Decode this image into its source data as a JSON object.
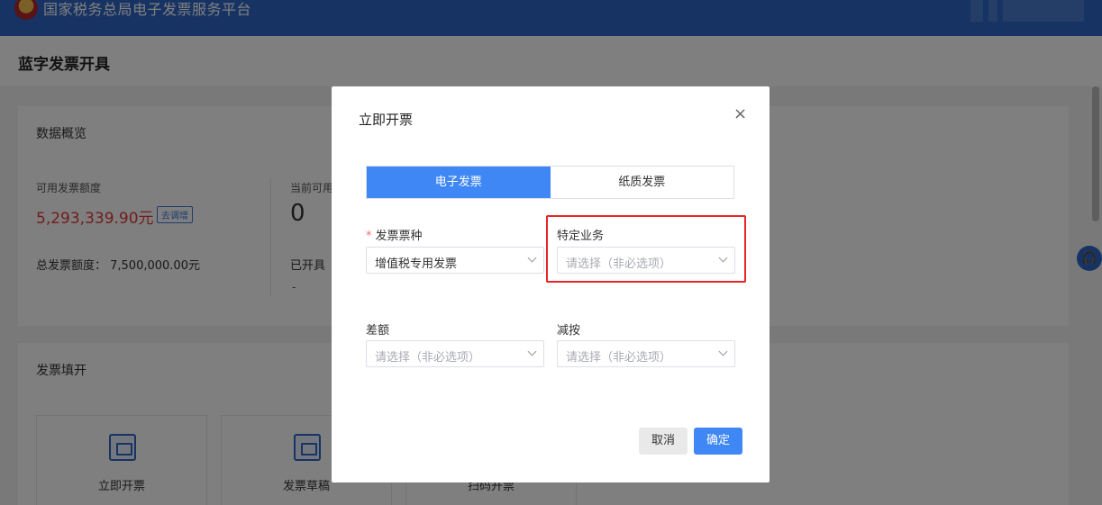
{
  "header": {
    "brand": "国家税务总局电子发票服务平台"
  },
  "page": {
    "title": "蓝字发票开具"
  },
  "overview": {
    "title": "数据概览",
    "available_label": "可用发票额度",
    "available_value": "5,293,339.90元",
    "adjust_link": "去调增",
    "total_line": "总发票额度： 7,500,000.00元",
    "current_label": "当前可用",
    "current_value": "0",
    "issued_label": "已开具",
    "issued_value": "-"
  },
  "fill": {
    "title": "发票填开",
    "tiles": [
      {
        "label": "立即开票"
      },
      {
        "label": "发票草稿"
      },
      {
        "label": "扫码开票"
      }
    ]
  },
  "modal": {
    "title": "立即开票",
    "close_glyph": "×",
    "tabs": [
      {
        "label": "电子发票",
        "active": true
      },
      {
        "label": "纸质发票",
        "active": false
      }
    ],
    "fields": {
      "invoice_type": {
        "required_mark": "*",
        "label": "发票票种",
        "value": "增值税专用发票"
      },
      "special_business": {
        "label": "特定业务",
        "placeholder": "请选择（非必选项）"
      },
      "difference": {
        "label": "差额",
        "placeholder": "请选择（非必选项）"
      },
      "reduction": {
        "label": "减按",
        "placeholder": "请选择（非必选项）"
      }
    },
    "cancel_label": "取消",
    "confirm_label": "确定"
  },
  "colors": {
    "primary": "#3f87f5",
    "header_bg": "#2e67c7",
    "highlight": "#e8242a",
    "amount_red": "#e4393c"
  }
}
